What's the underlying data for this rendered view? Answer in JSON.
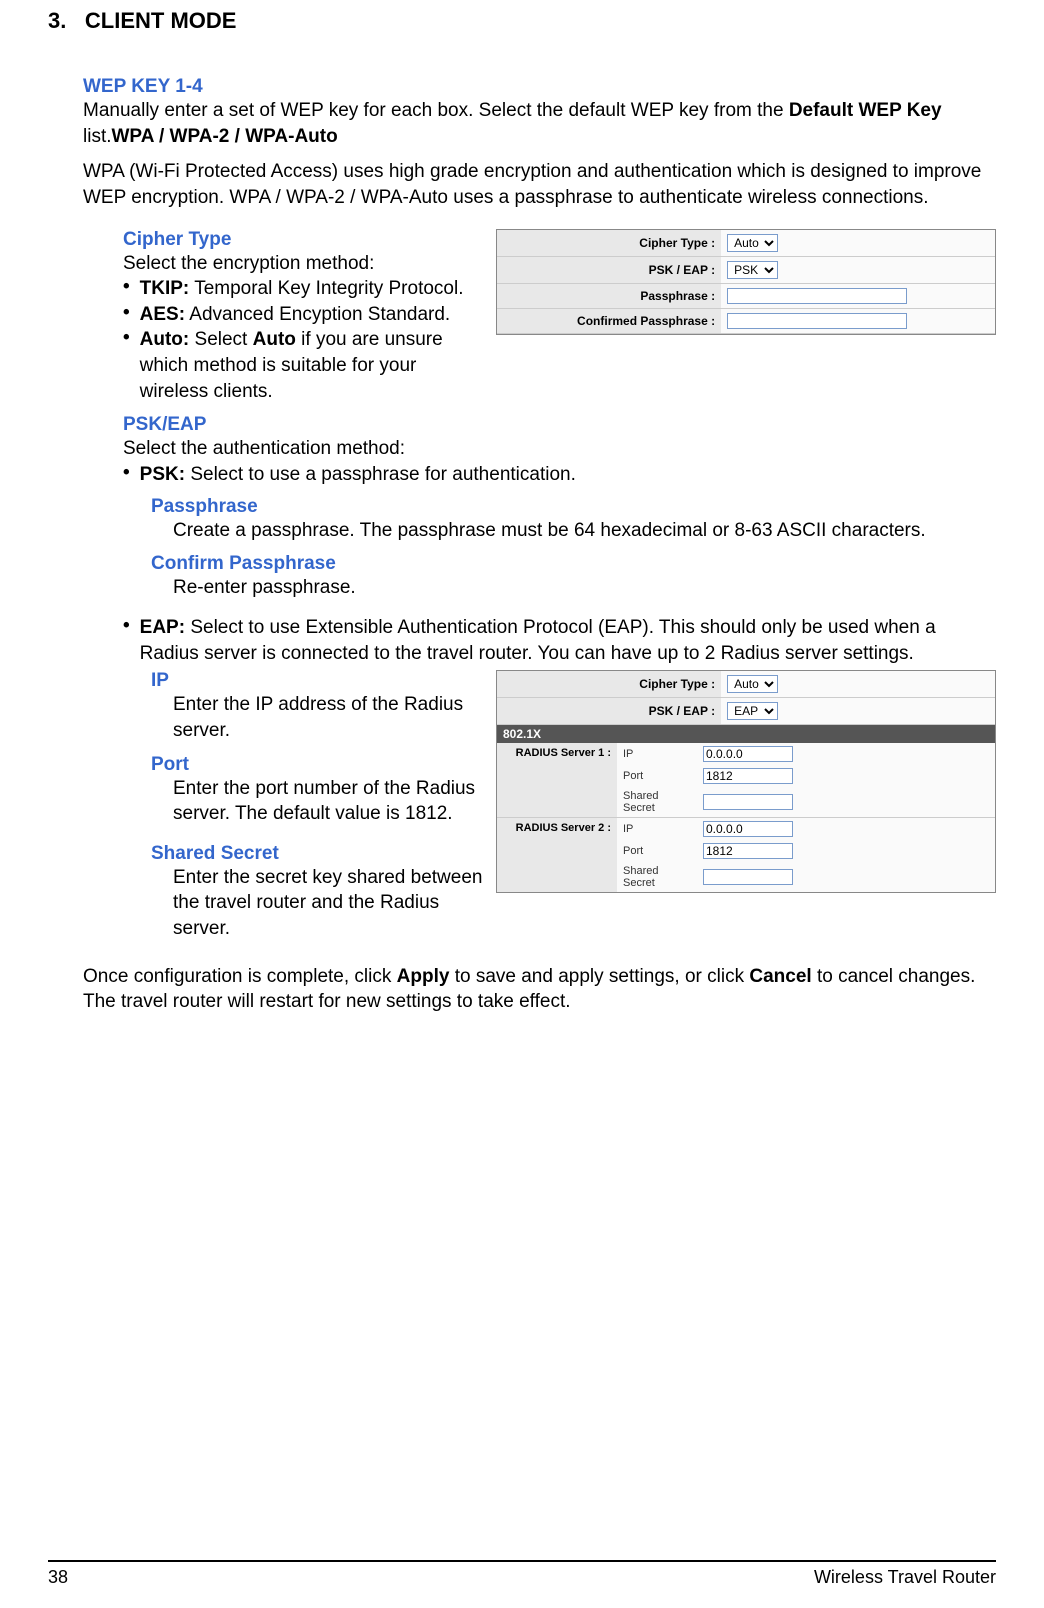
{
  "header": {
    "number": "3.",
    "title": "CLIENT MODE"
  },
  "wep": {
    "heading": "WEP KEY 1-4",
    "text_pre": "Manually enter a set of WEP key for each box. Select the default WEP key from the ",
    "bold_inline": "Default WEP Key",
    "text_mid": " list.",
    "bold_inline2": "WPA / WPA-2 / WPA-Auto"
  },
  "wpa_intro": "WPA (Wi-Fi Protected Access) uses high grade encryption and authentication which is designed to improve WEP encryption. WPA / WPA-2 / WPA-Auto uses a passphrase to authenticate wireless connections.",
  "cipher": {
    "heading": "Cipher Type",
    "intro": "Select the encryption method:",
    "tkip_b": "TKIP:",
    "tkip_t": " Temporal Key Integrity Protocol.",
    "aes_b": "AES:",
    "aes_t": " Advanced Encyption Standard.",
    "auto_b": "Auto:",
    "auto_pre": " Select ",
    "auto_bold": "Auto",
    "auto_t": " if you are unsure which method is suitable for your wireless clients."
  },
  "fig1": {
    "cipher_label": "Cipher Type :",
    "cipher_value": "Auto",
    "psk_label": "PSK / EAP :",
    "psk_value": "PSK",
    "pass_label": "Passphrase :",
    "cpass_label": "Confirmed Passphrase :"
  },
  "psk_eap": {
    "heading": "PSK/EAP",
    "intro": "Select the authentication method:",
    "psk_b": "PSK:",
    "psk_t": " Select to use a passphrase for authentication.",
    "pass_h": "Passphrase",
    "pass_t": "Create a passphrase. The passphrase must be 64 hexadecimal or 8-63 ASCII characters.",
    "cpass_h": "Confirm Passphrase",
    "cpass_t": "Re-enter passphrase.",
    "eap_b": "EAP:",
    "eap_t": " Select to use Extensible Authentication Protocol (EAP). This should only be used when a Radius server is connected to the travel router. You can have up to 2 Radius server settings.",
    "ip_h": "IP",
    "ip_t": "Enter the IP address of the Radius server.",
    "port_h": "Port",
    "port_t": "Enter the port number of the Radius server. The default value is 1812.",
    "ss_h": "Shared Secret",
    "ss_t": "Enter the secret key shared between the travel router and the Radius server."
  },
  "fig2": {
    "cipher_label": "Cipher Type :",
    "cipher_value": "Auto",
    "psk_label": "PSK / EAP :",
    "psk_value": "EAP",
    "section": "802.1X",
    "r1_label": "RADIUS Server 1 :",
    "r2_label": "RADIUS Server 2 :",
    "ip_l": "IP",
    "ip_v": "0.0.0.0",
    "port_l": "Port",
    "port_v": "1812",
    "ss_l": "Shared Secret"
  },
  "closing": {
    "p1": "Once configuration is complete, click ",
    "b1": "Apply",
    "p2": " to save and apply settings, or click ",
    "b2": "Cancel",
    "p3": " to cancel changes. The travel router will restart for new settings to take effect."
  },
  "footer": {
    "page": "38",
    "book": "Wireless Travel Router"
  }
}
